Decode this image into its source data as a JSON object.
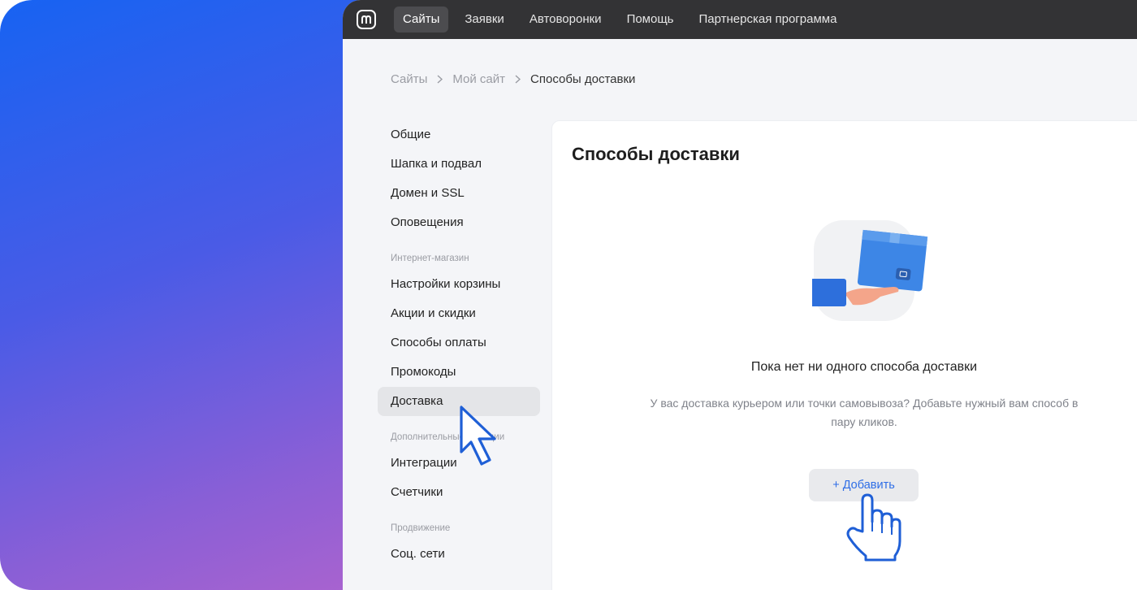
{
  "nav": {
    "items": [
      "Сайты",
      "Заявки",
      "Автоворонки",
      "Помощь",
      "Партнерская программа"
    ],
    "active_index": 0
  },
  "breadcrumb": [
    "Сайты",
    "Мой сайт",
    "Способы доставки"
  ],
  "sidebar": {
    "general": [
      "Общие",
      "Шапка и подвал",
      "Домен и SSL",
      "Оповещения"
    ],
    "shop_group": "Интернет-магазин",
    "shop": [
      "Настройки корзины",
      "Акции и скидки",
      "Способы оплаты",
      "Промокоды",
      "Доставка"
    ],
    "extra_group": "Дополнительные функции",
    "extra": [
      "Интеграции",
      "Счетчики"
    ],
    "promo_group": "Продвижение",
    "promo": [
      "Соц. сети"
    ],
    "active_item": "Доставка"
  },
  "main": {
    "title": "Способы доставки",
    "empty_title": "Пока нет ни одного способа доставки",
    "empty_desc": "У вас доставка курьером или точки самовывоза? Добавьте нужный вам способ в пару кликов.",
    "add_button": "+ Добавить"
  },
  "colors": {
    "accent": "#2f6ee6",
    "topbar": "#333335",
    "gradient_start": "#1763f2",
    "gradient_end": "#a963cf"
  }
}
